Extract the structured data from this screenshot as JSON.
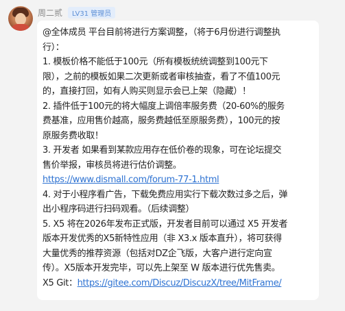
{
  "sender": {
    "name": "周二贰",
    "badge": "LV31 管理员"
  },
  "message": {
    "lines": [
      "@全体成员 平台目前将进行方案调整，（将于6月份进行调整执",
      "行）：",
      "1. 模板价格不能低于100元（所有模板统统调整到100元下",
      "限），之前的模板如果二次更新或者审核抽查，看了不值100元",
      "的，直接打回，如有人购买则显示会已上架（隐藏）！",
      "2. 插件低于100元的将大幅度上调倍率服务费（20-60%的服务",
      "费基准，应用售价越高，服务费越低至原服务费），100元的按",
      "原服务费收取！",
      "3. 开发者 如果看到某款应用存在低价卷的现象，可在论坛提交",
      "售价举报，审核员将进行估价调整。"
    ],
    "link1": "https://www.dismall.com/forum-77-1.html",
    "lines2": [
      "4. 对于小程序看广告，下载免费应用实行下载次数过多之后，弹",
      "出小程序码进行扫码观看。（后续调整）",
      "5. X5 将在2026年发布正式版，开发者目前可以通过 X5 开发者",
      "版本开发优秀的X5新特性应用（非 X3.x 版本直升），将可获得",
      "大量优秀的推荐资源（包括对DZ企飞版，大客户进行定向宣",
      "传）。X5版本开发完毕，可以先上架至 W 版本进行优先售卖。"
    ],
    "git_label": "X5 Git：",
    "link2": "https://gitee.com/Discuz/DiscuzX/tree/MitFrame/"
  }
}
